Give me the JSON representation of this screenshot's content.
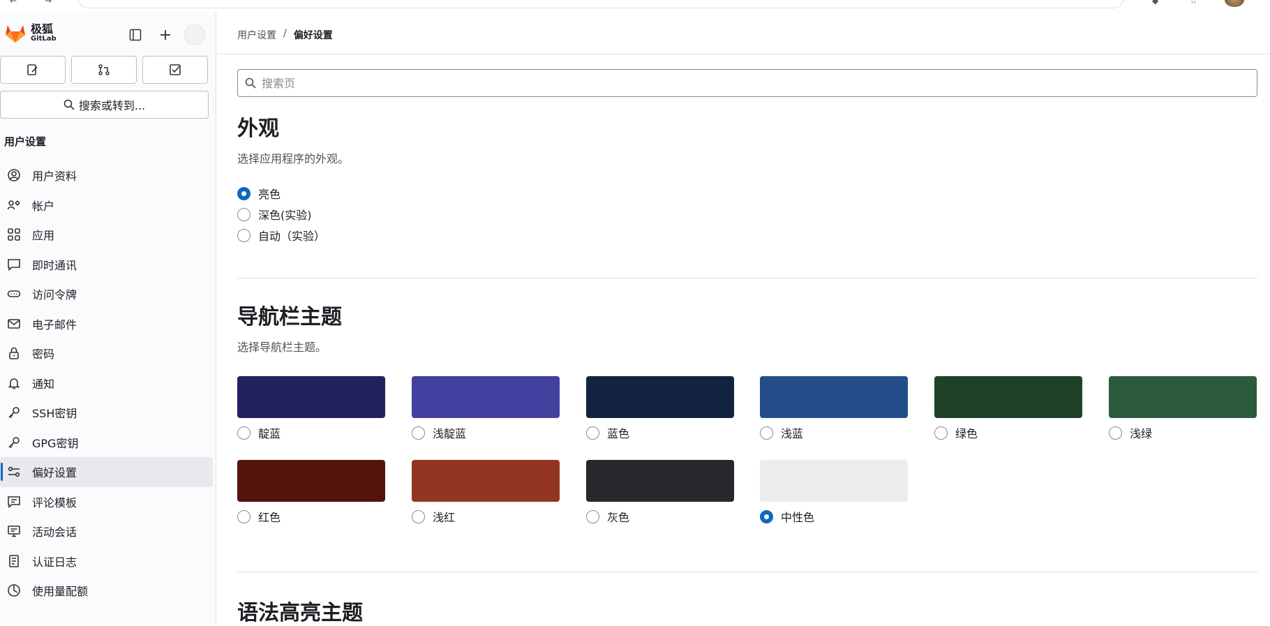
{
  "sidebar": {
    "brand_name": "极狐",
    "brand_sub": "GitLab",
    "search_label": "搜索或转到...",
    "section_title": "用户设置",
    "items": [
      {
        "label": "用户资料",
        "icon": "profile-icon"
      },
      {
        "label": "帐户",
        "icon": "account-icon"
      },
      {
        "label": "应用",
        "icon": "applications-icon"
      },
      {
        "label": "即时通讯",
        "icon": "chat-icon"
      },
      {
        "label": "访问令牌",
        "icon": "token-icon"
      },
      {
        "label": "电子邮件",
        "icon": "mail-icon"
      },
      {
        "label": "密码",
        "icon": "lock-icon"
      },
      {
        "label": "通知",
        "icon": "bell-icon"
      },
      {
        "label": "SSH密钥",
        "icon": "key-icon"
      },
      {
        "label": "GPG密钥",
        "icon": "key-icon"
      },
      {
        "label": "偏好设置",
        "icon": "preferences-icon",
        "active": true
      },
      {
        "label": "评论模板",
        "icon": "comment-template-icon"
      },
      {
        "label": "活动会话",
        "icon": "monitor-icon"
      },
      {
        "label": "认证日志",
        "icon": "log-icon"
      },
      {
        "label": "使用量配额",
        "icon": "quota-icon"
      }
    ]
  },
  "breadcrumb": {
    "parent": "用户设置",
    "separator": "/",
    "current": "偏好设置"
  },
  "search": {
    "placeholder": "搜索页"
  },
  "appearance": {
    "title": "外观",
    "description": "选择应用程序的外观。",
    "options": [
      {
        "label": "亮色",
        "checked": true
      },
      {
        "label": "深色(实验)",
        "checked": false
      },
      {
        "label": "自动（实验）",
        "checked": false
      }
    ]
  },
  "navbar_theme": {
    "title": "导航栏主题",
    "description": "选择导航栏主题。",
    "themes": [
      {
        "label": "靛蓝",
        "color": "#222261",
        "checked": false
      },
      {
        "label": "浅靛蓝",
        "color": "#41419f",
        "checked": false
      },
      {
        "label": "蓝色",
        "color": "#13233f",
        "checked": false
      },
      {
        "label": "浅蓝",
        "color": "#234e8a",
        "checked": false
      },
      {
        "label": "绿色",
        "color": "#1f4128",
        "checked": false
      },
      {
        "label": "浅绿",
        "color": "#2c5a3d",
        "checked": false
      },
      {
        "label": "红色",
        "color": "#52140b",
        "checked": false
      },
      {
        "label": "浅红",
        "color": "#923623",
        "checked": false
      },
      {
        "label": "灰色",
        "color": "#28272d",
        "checked": false
      },
      {
        "label": "中性色",
        "color": "#ececef",
        "checked": true
      }
    ]
  },
  "syntax_theme": {
    "title": "语法高亮主题"
  },
  "colors": {
    "accent": "#1068bf"
  }
}
